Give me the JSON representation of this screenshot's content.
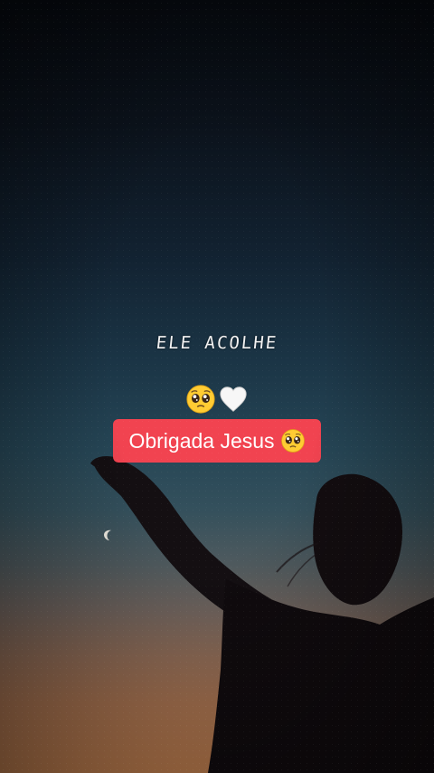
{
  "overlay": {
    "title_text": "ELE ACOLHE",
    "emoji_row": [
      "pleading-face-emoji",
      "white-heart-emoji"
    ],
    "caption_text": "Obrigada Jesus",
    "caption_emoji": "pleading-face-emoji",
    "caption_bg_color": "#f14350"
  },
  "scene": {
    "sky_colors": [
      "#06090e",
      "#1b3546",
      "#34505c",
      "#b97a4c"
    ],
    "silhouette_color": "#0f0b0d"
  }
}
